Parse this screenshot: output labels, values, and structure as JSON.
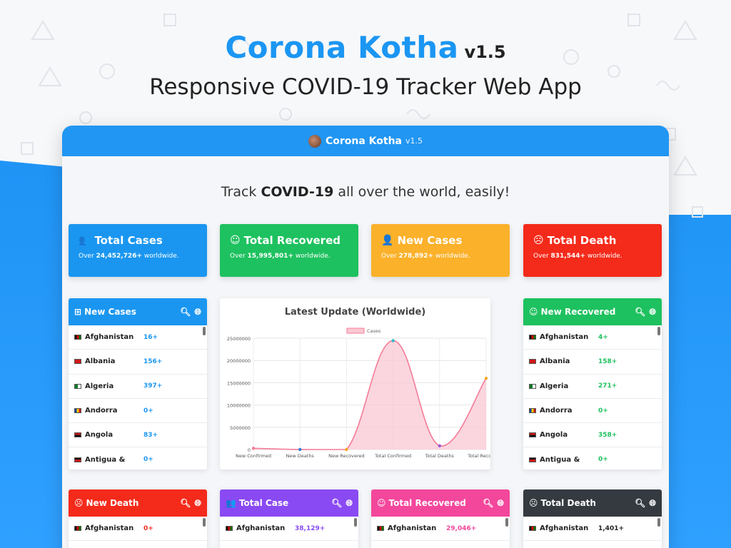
{
  "promo": {
    "brand": "Corona Kotha",
    "version": "v1.5",
    "subtitle": "Responsive COVID-19 Tracker Web App"
  },
  "navbar": {
    "brand": "Corona Kotha",
    "version": "v1.5"
  },
  "tagline": {
    "pre": "Track ",
    "bold": "COVID-19",
    "post": " all over the world, easily!"
  },
  "stat_cards": [
    {
      "title": "Total Cases",
      "icon": "users-icon",
      "glyph": "👥",
      "pre": "Over ",
      "number": "24,452,726+",
      "post": " worldwide.",
      "color": "#1a96f0"
    },
    {
      "title": "Total Recovered",
      "icon": "smile-icon",
      "glyph": "☺",
      "pre": "Over ",
      "number": "15,995,801+",
      "post": " worldwide.",
      "color": "#1ec15f"
    },
    {
      "title": "New Cases",
      "icon": "user-plus-icon",
      "glyph": "👤",
      "pre": "Over ",
      "number": "278,892+",
      "post": " worldwide.",
      "color": "#fbb12a"
    },
    {
      "title": "Total Death",
      "icon": "sad-icon",
      "glyph": "☹",
      "pre": "Over ",
      "number": "831,544+",
      "post": " worldwide.",
      "color": "#f42a1a"
    }
  ],
  "panels_top": [
    {
      "title": "New Cases",
      "icon": "plus-square-icon",
      "glyph": "⊞",
      "color": "#1a96f0",
      "value_color": "#1a96f0",
      "rows": [
        {
          "country": "Afghanistan",
          "value": "16+"
        },
        {
          "country": "Albania",
          "value": "156+"
        },
        {
          "country": "Algeria",
          "value": "397+"
        },
        {
          "country": "Andorra",
          "value": "0+"
        },
        {
          "country": "Angola",
          "value": "83+"
        },
        {
          "country": "Antigua &",
          "value": "0+"
        }
      ]
    },
    {
      "title": "New Recovered",
      "icon": "smile-icon",
      "glyph": "☺",
      "color": "#1ec15f",
      "value_color": "#1ec15f",
      "rows": [
        {
          "country": "Afghanistan",
          "value": "4+"
        },
        {
          "country": "Albania",
          "value": "158+"
        },
        {
          "country": "Algeria",
          "value": "271+"
        },
        {
          "country": "Andorra",
          "value": "0+"
        },
        {
          "country": "Angola",
          "value": "358+"
        },
        {
          "country": "Antigua &",
          "value": "0+"
        }
      ]
    }
  ],
  "panels_bottom": [
    {
      "title": "New Death",
      "icon": "skull-icon",
      "glyph": "☹",
      "color": "#f42a1a",
      "value_color": "#f42a1a",
      "rows": [
        {
          "country": "Afghanistan",
          "value": "0+"
        }
      ]
    },
    {
      "title": "Total Case",
      "icon": "users-icon",
      "glyph": "👥",
      "color": "#8a4af3",
      "value_color": "#8a4af3",
      "rows": [
        {
          "country": "Afghanistan",
          "value": "38,129+"
        }
      ]
    },
    {
      "title": "Total Recovered",
      "icon": "smile-icon",
      "glyph": "☺",
      "color": "#f3479c",
      "value_color": "#f3479c",
      "rows": [
        {
          "country": "Afghanistan",
          "value": "29,046+"
        }
      ]
    },
    {
      "title": "Total Death",
      "icon": "skull-icon",
      "glyph": "☹",
      "color": "#343a40",
      "value_color": "#222222",
      "rows": [
        {
          "country": "Afghanistan",
          "value": "1,401+"
        }
      ]
    }
  ],
  "chart_data": {
    "type": "area",
    "title": "Latest Update (Worldwide)",
    "xlabel": "",
    "ylabel": "",
    "categories": [
      "New Confirmed",
      "New Deaths",
      "New Recovered",
      "Total Confirmed",
      "Total Deaths",
      "Total Recovered"
    ],
    "series": [
      {
        "name": "Cases",
        "values": [
          278892,
          5000,
          0,
          24452726,
          831544,
          15995801
        ]
      }
    ],
    "ylim": [
      0,
      25000000
    ],
    "yticks": [
      "0",
      "5000000",
      "10000000",
      "15000000",
      "20000000",
      "25000000"
    ],
    "line_color": "#f47c97",
    "fill_color": "#f9c8d3",
    "point_colors": [
      "#f47c97",
      "#2f7fd6",
      "#f5a623",
      "#2fb9c5",
      "#9b59d6",
      "#f5a623"
    ],
    "grid": true,
    "legend": "top"
  }
}
